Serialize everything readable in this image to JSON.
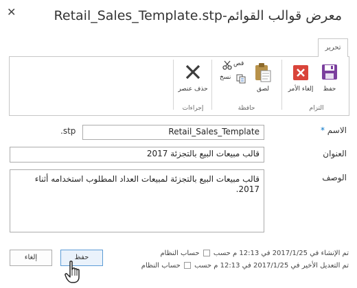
{
  "dialog": {
    "title": "معرض قوالب القوائم-Retail_Sales_Template.stp",
    "close_glyph": "✕"
  },
  "ribbon": {
    "tab": "تحرير",
    "groups": {
      "commit": {
        "label": "التزام",
        "save": "حفظ",
        "cancel": "إلغاء الأمر"
      },
      "clipboard": {
        "label": "حافظة",
        "paste": "لصق",
        "cut": "قص",
        "copy": "نسخ"
      },
      "actions": {
        "label": "إجراءات",
        "delete": "حذف عنصر"
      }
    }
  },
  "form": {
    "name": {
      "label": "الاسم",
      "required_mark": "*",
      "value": "Retail_Sales_Template",
      "suffix": ".stp"
    },
    "title": {
      "label": "العنوان",
      "value": "قالب مبيعات البيع بالتجزئة 2017"
    },
    "description": {
      "label": "الوصف",
      "value": "قالب مبيعات البيع بالتجزئة لمبيعات العداد المطلوب استخدامه أثناء 2017."
    }
  },
  "meta": {
    "created": {
      "prefix": "تم الإنشاء في 2017/1/25 في 12:13 م  حسب",
      "user": "حساب النظام"
    },
    "modified": {
      "prefix": "تم التعديل الأخير في 2017/1/25 في 12:13 م  حسب",
      "user": "حساب النظام"
    }
  },
  "buttons": {
    "save": "حفظ",
    "cancel": "إلغاء"
  },
  "colors": {
    "accent": "#0072c6",
    "save_purple": "#7b3f9e",
    "cancel_red": "#d9443a",
    "paste_gold": "#e6b34a"
  }
}
